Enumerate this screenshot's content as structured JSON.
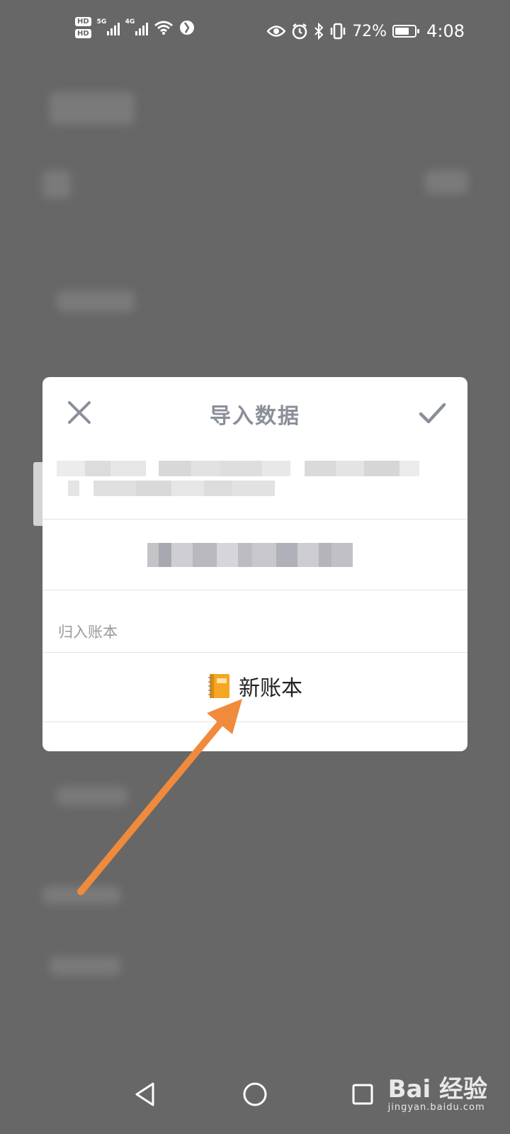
{
  "status_bar": {
    "sim1": "HD",
    "sim2": "HD",
    "net1": "5G",
    "net2": "4G",
    "battery_percent_text": "72%",
    "battery_level": 0.72,
    "time": "4:08",
    "icons": [
      "eye-icon",
      "alarm-icon",
      "bluetooth-icon",
      "vibrate-icon"
    ]
  },
  "dialog": {
    "title": "导入数据",
    "section_label": "归入账本",
    "ledger": {
      "icon": "notebook-icon",
      "name": "新账本"
    }
  },
  "nav_bar": {
    "buttons": [
      "back-icon",
      "home-icon",
      "recents-icon"
    ]
  },
  "watermark": {
    "main": "Bai  经验",
    "sub": "jingyan.baidu.com"
  },
  "colors": {
    "overlay": "#676767",
    "dialog_bg": "#ffffff",
    "title_gray": "#8a8f99",
    "arrow": "#f08a3c",
    "notebook": "#f5a623"
  }
}
